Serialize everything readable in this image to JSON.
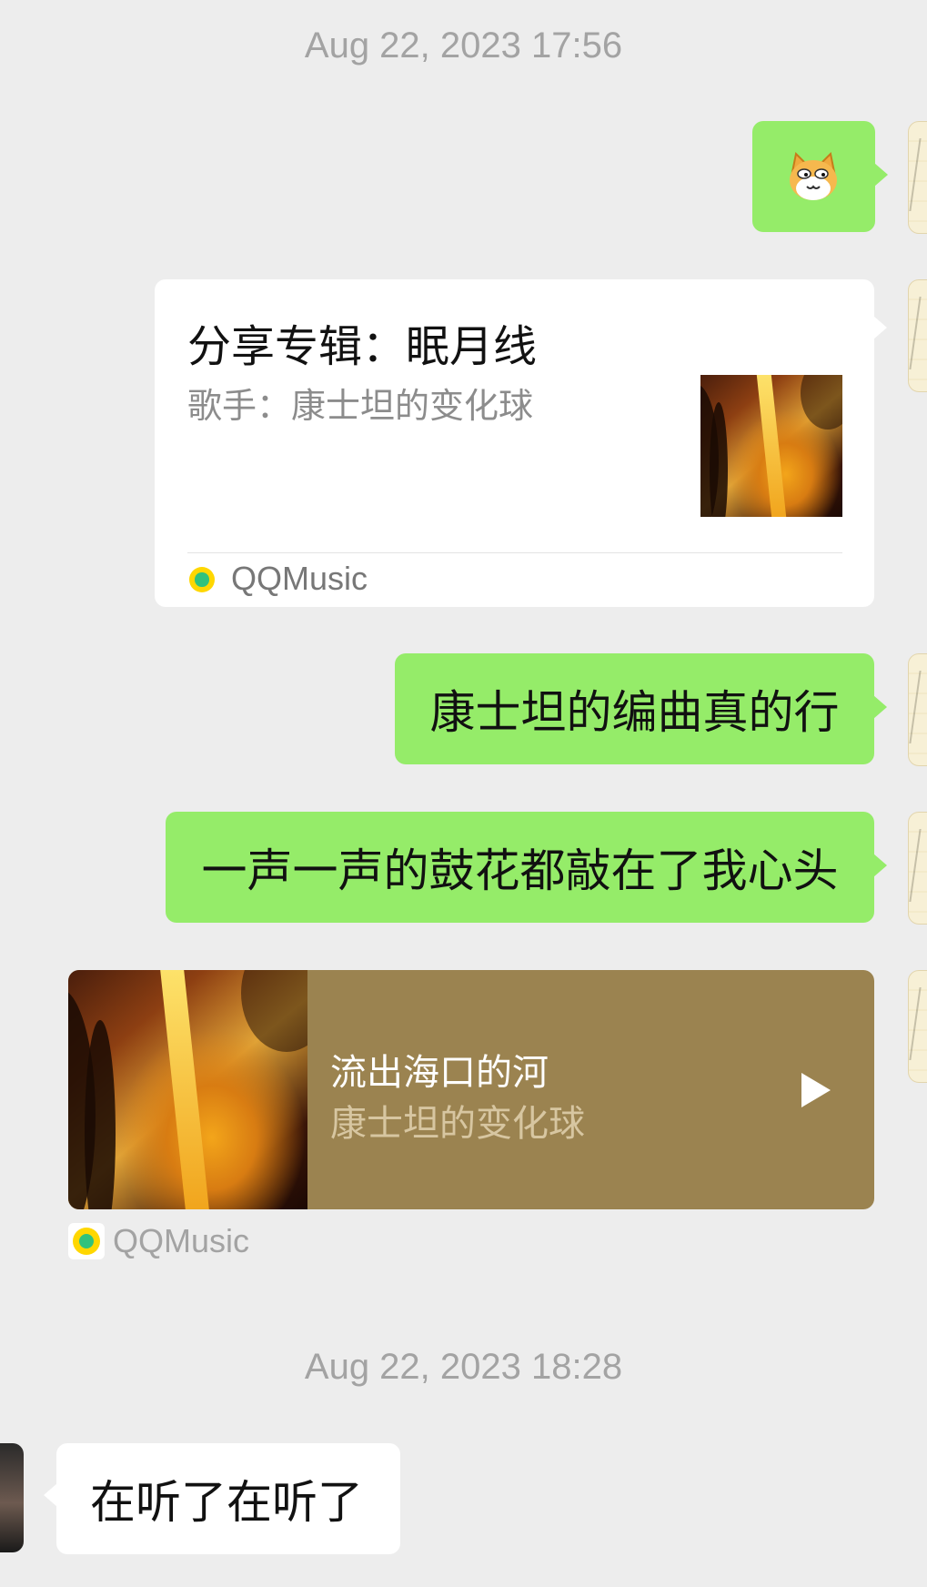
{
  "timestamps": [
    "Aug 22, 2023 17:56",
    "Aug 22, 2023 18:28"
  ],
  "messages": {
    "sticker": {
      "icon": "cat-sticker-icon"
    },
    "album_card": {
      "title": "分享专辑：眠月线",
      "artist": "歌手：康士坦的变化球",
      "source": "QQMusic"
    },
    "text1": "康士坦的编曲真的行",
    "text2": "一声一声的鼓花都敲在了我心头",
    "music_player": {
      "song": "流出海口的河",
      "artist": "康士坦的变化球",
      "source": "QQMusic"
    },
    "reply": "在听了在听了"
  },
  "colors": {
    "background": "#ededed",
    "green_bubble": "#95ec69",
    "player_bg": "#9b8350",
    "timestamp": "#a3a3a3"
  }
}
